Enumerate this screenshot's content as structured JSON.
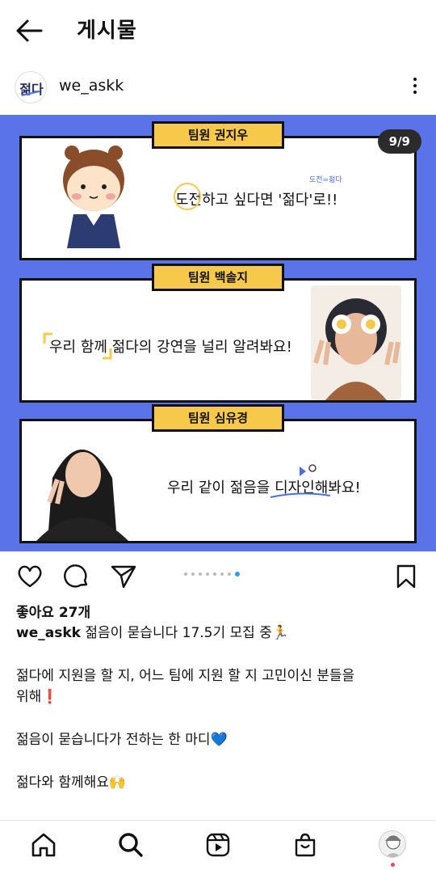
{
  "header": {
    "title": "게시물"
  },
  "post": {
    "username": "we_askk",
    "logo_text": "젊다",
    "slide_counter": "9/9",
    "slide_count": 9,
    "active_slide": 9,
    "panels": [
      {
        "tag": "팀원 권지우",
        "text": "도전하고 싶다면 '젊다'로!!",
        "note": "도전=젊다"
      },
      {
        "tag": "팀원 백솔지",
        "text": "우리 함께 젊다의 강연을 널리 알려봐요!"
      },
      {
        "tag": "팀원 심유경",
        "text": "우리 같이 젊음을 디자인해봐요!"
      }
    ],
    "colors": {
      "background": "#5b73e8",
      "tag": "#f7c94b",
      "dot_active": "#3897f0"
    },
    "likes": "좋아요 27개",
    "caption": {
      "username": "we_askk",
      "line1": "젊음이 묻습니다 17.5기 모집 중🏃",
      "line2": "젊다에 지원을 할 지, 어느 팀에 지원 할 지 고민이신 분들을",
      "line3": "위해❗",
      "line4": "젊음이 묻습니다가 전하는 한 마디💙",
      "line5": "젊다와 함께해요🙌"
    }
  },
  "icons": {
    "back": "arrow-left-icon",
    "more": "more-vertical-icon",
    "like": "heart-icon",
    "comment": "comment-icon",
    "share": "send-icon",
    "save": "bookmark-icon",
    "nav": [
      "home-icon",
      "search-icon",
      "reels-icon",
      "shop-icon",
      "profile-avatar"
    ]
  }
}
